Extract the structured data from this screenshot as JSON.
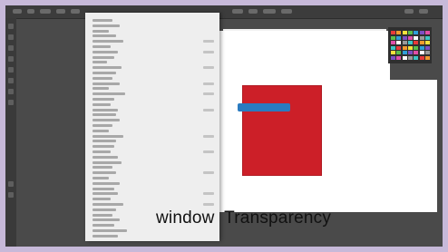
{
  "caption": {
    "text": "window  Transparency"
  },
  "colors": {
    "background": "#c7b9d9",
    "app_bg": "#4a4a4a",
    "menu_bg": "#eeeeee",
    "canvas": "#ffffff",
    "shape_red": "#cc1f28",
    "shape_blue": "#2a7bc0"
  },
  "menu": {
    "item_count": 42
  }
}
